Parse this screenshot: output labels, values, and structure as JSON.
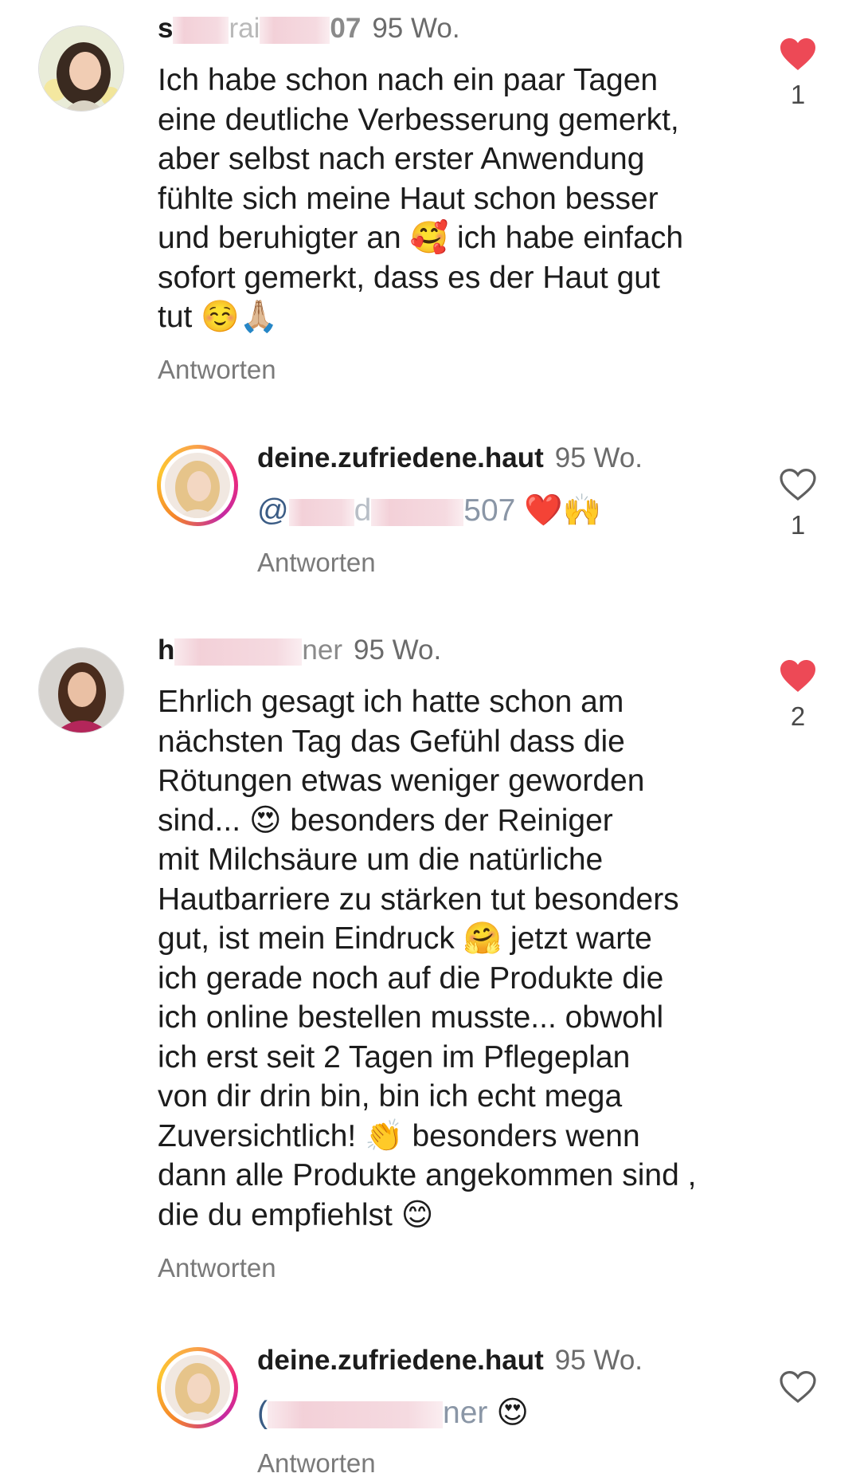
{
  "comments": [
    {
      "username_start": "s",
      "username_mid": "rai",
      "username_end": "07",
      "time": "95 Wo.",
      "text_lines": [
        "Ich habe schon nach ein paar Tagen",
        "eine deutliche Verbesserung gemerkt,",
        "aber selbst nach erster Anwendung",
        "fühlte sich meine Haut schon besser",
        "und beruhigter an 🥰 ich habe einfach",
        "sofort gemerkt, dass es der Haut gut",
        "tut ☺️🙏🏼"
      ],
      "reply_label": "Antworten",
      "like_count": "1",
      "liked": true
    },
    {
      "username": "deine.zufriedene.haut",
      "time": "95 Wo.",
      "mention_start": "@",
      "mention_mid": "d",
      "mention_end": "507",
      "mention_emoji": "❤️🙌",
      "reply_label": "Antworten",
      "like_count": "1",
      "liked": false
    },
    {
      "username_start": "h",
      "username_end": "ner",
      "time": "95 Wo.",
      "text_lines": [
        "Ehrlich gesagt ich hatte schon am",
        "nächsten Tag das Gefühl dass die",
        "Rötungen etwas weniger geworden",
        "sind... 😍 besonders der Reiniger",
        "mit Milchsäure um die natürliche",
        "Hautbarriere zu stärken tut besonders",
        "gut, ist mein Eindruck 🤗 jetzt warte",
        "ich gerade noch auf die Produkte die",
        "ich online bestellen musste... obwohl",
        "ich erst seit 2 Tagen im Pflegeplan",
        "von dir drin bin, bin ich echt mega",
        "Zuversichtlich! 👏 besonders wenn",
        "dann alle Produkte angekommen sind ,",
        "die du empfiehlst 😊"
      ],
      "reply_label": "Antworten",
      "like_count": "2",
      "liked": true
    },
    {
      "username": "deine.zufriedene.haut",
      "time": "95 Wo.",
      "mention_start": "(",
      "mention_end": "ner",
      "mention_emoji": "😍",
      "reply_label": "Antworten",
      "liked": false
    }
  ],
  "colors": {
    "heart_liked": "#ed4956",
    "heart_outline": "#262626",
    "muted": "#6b6b6b"
  },
  "icons": {
    "like": "heart-icon",
    "avatar": "avatar-image"
  }
}
